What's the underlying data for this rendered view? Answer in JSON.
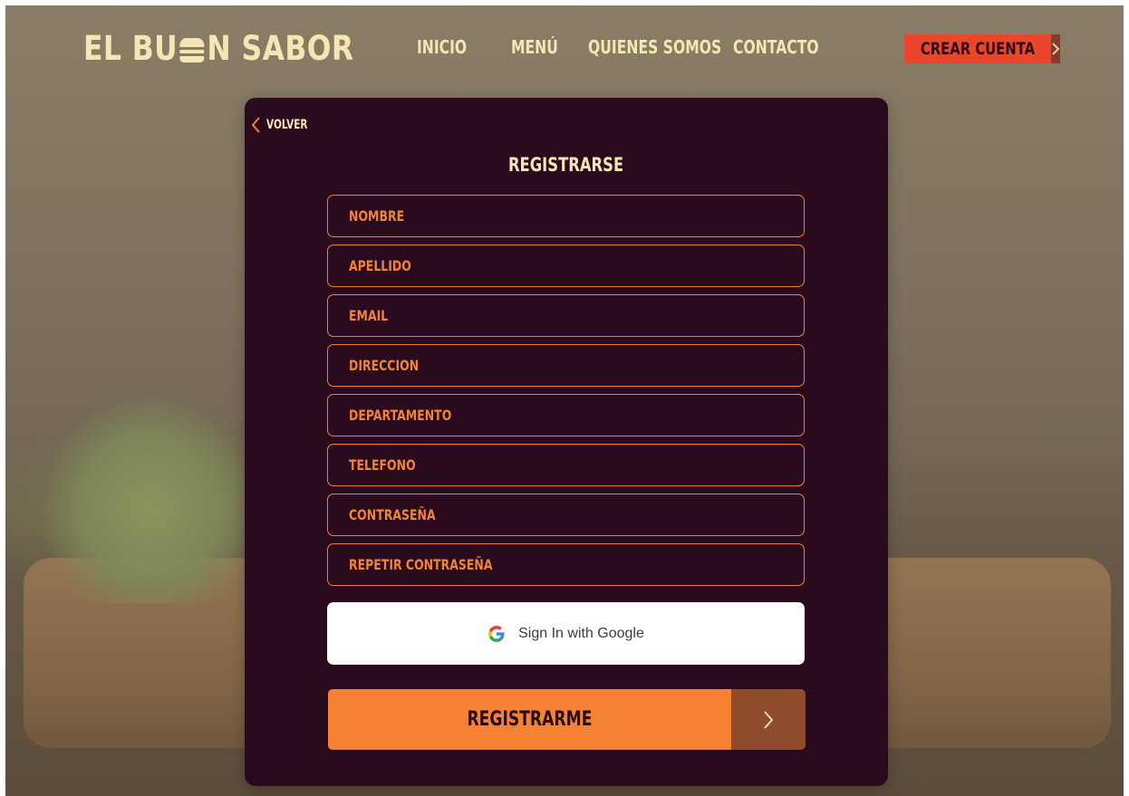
{
  "brand": {
    "logo_left": "EL BU",
    "logo_right": "N SABOR",
    "logo_color": "#f5e6b4"
  },
  "nav": {
    "items": [
      {
        "label": "INICIO"
      },
      {
        "label": "MENÚ"
      },
      {
        "label": "QUIENES SOMOS"
      },
      {
        "label": "CONTACTO"
      }
    ],
    "cta_label": "CREAR CUENTA",
    "cta_icon": "chevron-right-icon",
    "cta_color": "#e8472b"
  },
  "form": {
    "back_label": "VOLVER",
    "back_icon": "chevron-left-icon",
    "title": "REGISTRARSE",
    "fields": [
      {
        "placeholder": "NOMBRE",
        "value": ""
      },
      {
        "placeholder": "APELLIDO",
        "value": ""
      },
      {
        "placeholder": "EMAIL",
        "value": ""
      },
      {
        "placeholder": "DIRECCION",
        "value": ""
      },
      {
        "placeholder": "DEPARTAMENTO",
        "value": ""
      },
      {
        "placeholder": "TELEFONO",
        "value": ""
      },
      {
        "placeholder": "CONTRASEÑA",
        "value": ""
      },
      {
        "placeholder": "REPETIR CONTRASEÑA",
        "value": ""
      }
    ],
    "google_label": "Sign In with Google",
    "google_icon": "google-icon",
    "submit_label": "REGISTRARME",
    "submit_icon": "chevron-right-icon",
    "accent_color": "#f58233",
    "card_color": "#2a0b1e"
  }
}
